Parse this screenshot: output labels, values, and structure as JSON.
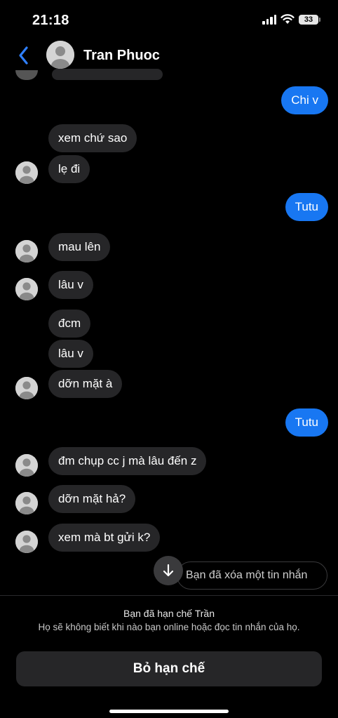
{
  "status_bar": {
    "time": "21:18",
    "battery": "33"
  },
  "header": {
    "contact_name": "Tran Phuoc"
  },
  "messages": [
    {
      "side": "out",
      "text": "Chi v"
    },
    {
      "side": "in",
      "text": "xem chứ sao"
    },
    {
      "side": "in",
      "text": "lẹ đi"
    },
    {
      "side": "out",
      "text": "Tutu"
    },
    {
      "side": "in",
      "text": "mau lên"
    },
    {
      "side": "in",
      "text": "lâu v"
    },
    {
      "side": "in",
      "text": "đcm"
    },
    {
      "side": "in",
      "text": "lâu v"
    },
    {
      "side": "in",
      "text": "dỡn mặt à"
    },
    {
      "side": "out",
      "text": "Tutu"
    },
    {
      "side": "in",
      "text": "đm chụp cc j mà lâu đến z"
    },
    {
      "side": "in",
      "text": "dỡn mặt hả?"
    },
    {
      "side": "in",
      "text": "xem mà bt gửi k?"
    }
  ],
  "deleted_notice": "Bạn đã xóa một tin nhắn",
  "restriction": {
    "title": "Bạn đã hạn chế Trần",
    "description": "Họ sẽ không biết khi nào bạn online hoặc đọc tin nhắn của họ.",
    "button_label": "Bỏ hạn chế"
  },
  "colors": {
    "outgoing_bubble": "#1877f2",
    "incoming_bubble": "#262628",
    "back_arrow": "#2f80ff"
  }
}
